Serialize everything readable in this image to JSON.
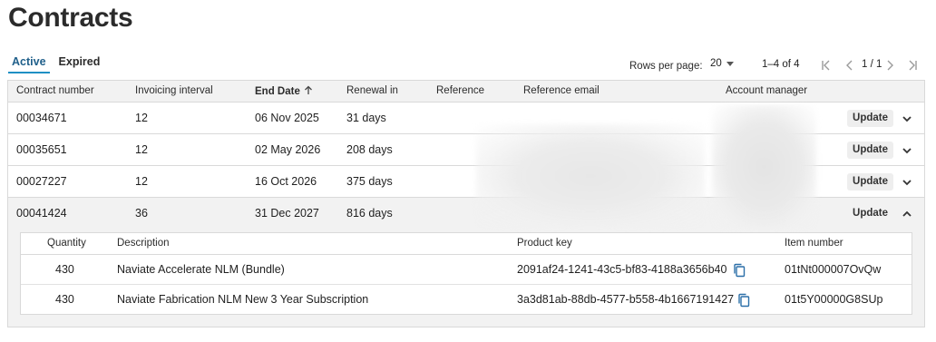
{
  "page": {
    "title": "Contracts"
  },
  "tabs": [
    {
      "label": "Active",
      "active": true
    },
    {
      "label": "Expired",
      "active": false
    }
  ],
  "pagination": {
    "rows_per_page_label": "Rows per page:",
    "rows_per_page_value": "20",
    "range": "1–4 of 4",
    "page_indicator": "1 / 1"
  },
  "table": {
    "columns": [
      "Contract number",
      "Invoicing interval",
      "End Date",
      "Renewal in",
      "Reference",
      "Reference email",
      "Account manager"
    ],
    "sorted_column": "End Date",
    "sort_direction": "ascending",
    "update_label": "Update",
    "rows": [
      {
        "contract_number": "00034671",
        "invoicing_interval": "12",
        "end_date": "06 Nov 2025",
        "renewal_in": "31 days",
        "expanded": false
      },
      {
        "contract_number": "00035651",
        "invoicing_interval": "12",
        "end_date": "02 May 2026",
        "renewal_in": "208 days",
        "expanded": false
      },
      {
        "contract_number": "00027227",
        "invoicing_interval": "12",
        "end_date": "16 Oct 2026",
        "renewal_in": "375 days",
        "expanded": false
      },
      {
        "contract_number": "00041424",
        "invoicing_interval": "36",
        "end_date": "31 Dec 2027",
        "renewal_in": "816 days",
        "expanded": true
      }
    ]
  },
  "detail": {
    "columns": [
      "Quantity",
      "Description",
      "Product key",
      "Item number"
    ],
    "rows": [
      {
        "quantity": "430",
        "description": "Naviate Accelerate NLM (Bundle)",
        "product_key": "2091af24-1241-43c5-bf83-4188a3656b40",
        "item_number": "01tNt000007OvQw"
      },
      {
        "quantity": "430",
        "description": "Naviate Fabrication NLM New 3 Year Subscription",
        "product_key": "3a3d81ab-88db-4577-b558-4b1667191427",
        "item_number": "01t5Y00000G8SUp"
      }
    ]
  },
  "colors": {
    "accent": "#1f8fc4",
    "copy_icon": "#2b6fa8",
    "border": "#d9d9d9"
  }
}
